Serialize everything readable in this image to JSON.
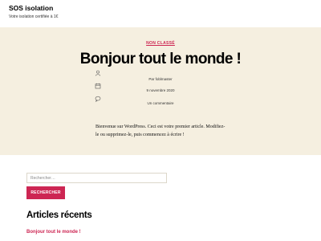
{
  "site": {
    "title": "SOS isolation",
    "description": "Votre isolation certifiée à 1€"
  },
  "post": {
    "category": "NON CLASSÉ",
    "title": "Bonjour tout le monde !",
    "author": "Par foblmaster",
    "date": "9 novembre 2020",
    "comments": "Un commentaire",
    "excerpt": "Bienvenue sur WordPress. Ceci est votre premier article. Modifiez-le ou supprimez-le, puis commencez à écrire !"
  },
  "search": {
    "placeholder": "Rechercher…",
    "button_label": "RECHERCHER"
  },
  "recent": {
    "heading": "Articles récents",
    "items": [
      "Bonjour tout le monde !"
    ]
  },
  "colors": {
    "accent": "#cd2653",
    "post_background": "#f5efe0"
  },
  "icons": {
    "author": "person-icon",
    "date": "calendar-icon",
    "comments": "comment-bubble-icon"
  }
}
